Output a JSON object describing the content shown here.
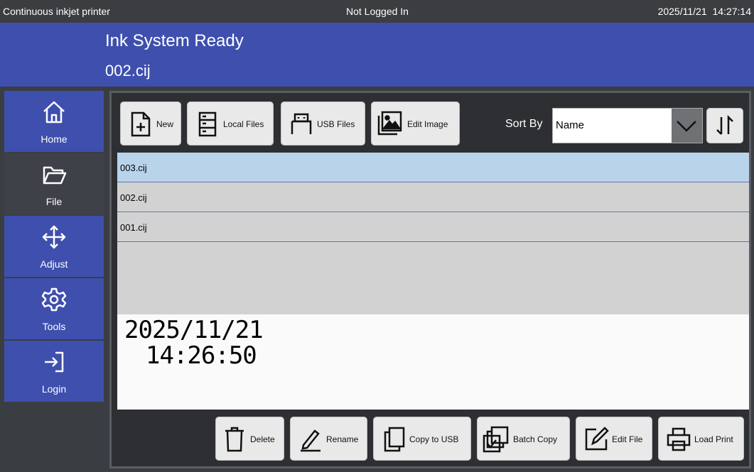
{
  "topbar": {
    "app_name": "Continuous inkjet printer",
    "login_status": "Not Logged In",
    "datetime": "2025/11/21 14:27:14"
  },
  "header": {
    "system_status": "Ink System Ready",
    "current_file": "002.cij"
  },
  "sidebar": {
    "items": [
      {
        "label": "Home",
        "icon": "home-icon"
      },
      {
        "label": "File",
        "icon": "folder-icon",
        "active": true
      },
      {
        "label": "Adjust",
        "icon": "move-icon"
      },
      {
        "label": "Tools",
        "icon": "gear-icon"
      },
      {
        "label": "Login",
        "icon": "login-icon"
      }
    ]
  },
  "toolbar": {
    "new_label": "New",
    "local_files_label": "Local Files",
    "usb_files_label": "USB Files",
    "edit_image_label": "Edit Image",
    "sort_by_label": "Sort By",
    "sort_value": "Name"
  },
  "files": [
    "003.cij",
    "002.cij",
    "001.cij"
  ],
  "selected_file": "003.cij",
  "preview": {
    "line1": "2025/11/21",
    "line2": "14:26:50"
  },
  "actions": {
    "delete_label": "Delete",
    "rename_label": "Rename",
    "copy_to_usb_label": "Copy to USB",
    "batch_copy_label": "Batch Copy",
    "edit_file_label": "Edit File",
    "load_print_label": "Load Print"
  },
  "colors": {
    "header_blue": "#3f4fae",
    "selected_row": "#b9d3eb",
    "dark_panel": "#2d2f33"
  }
}
